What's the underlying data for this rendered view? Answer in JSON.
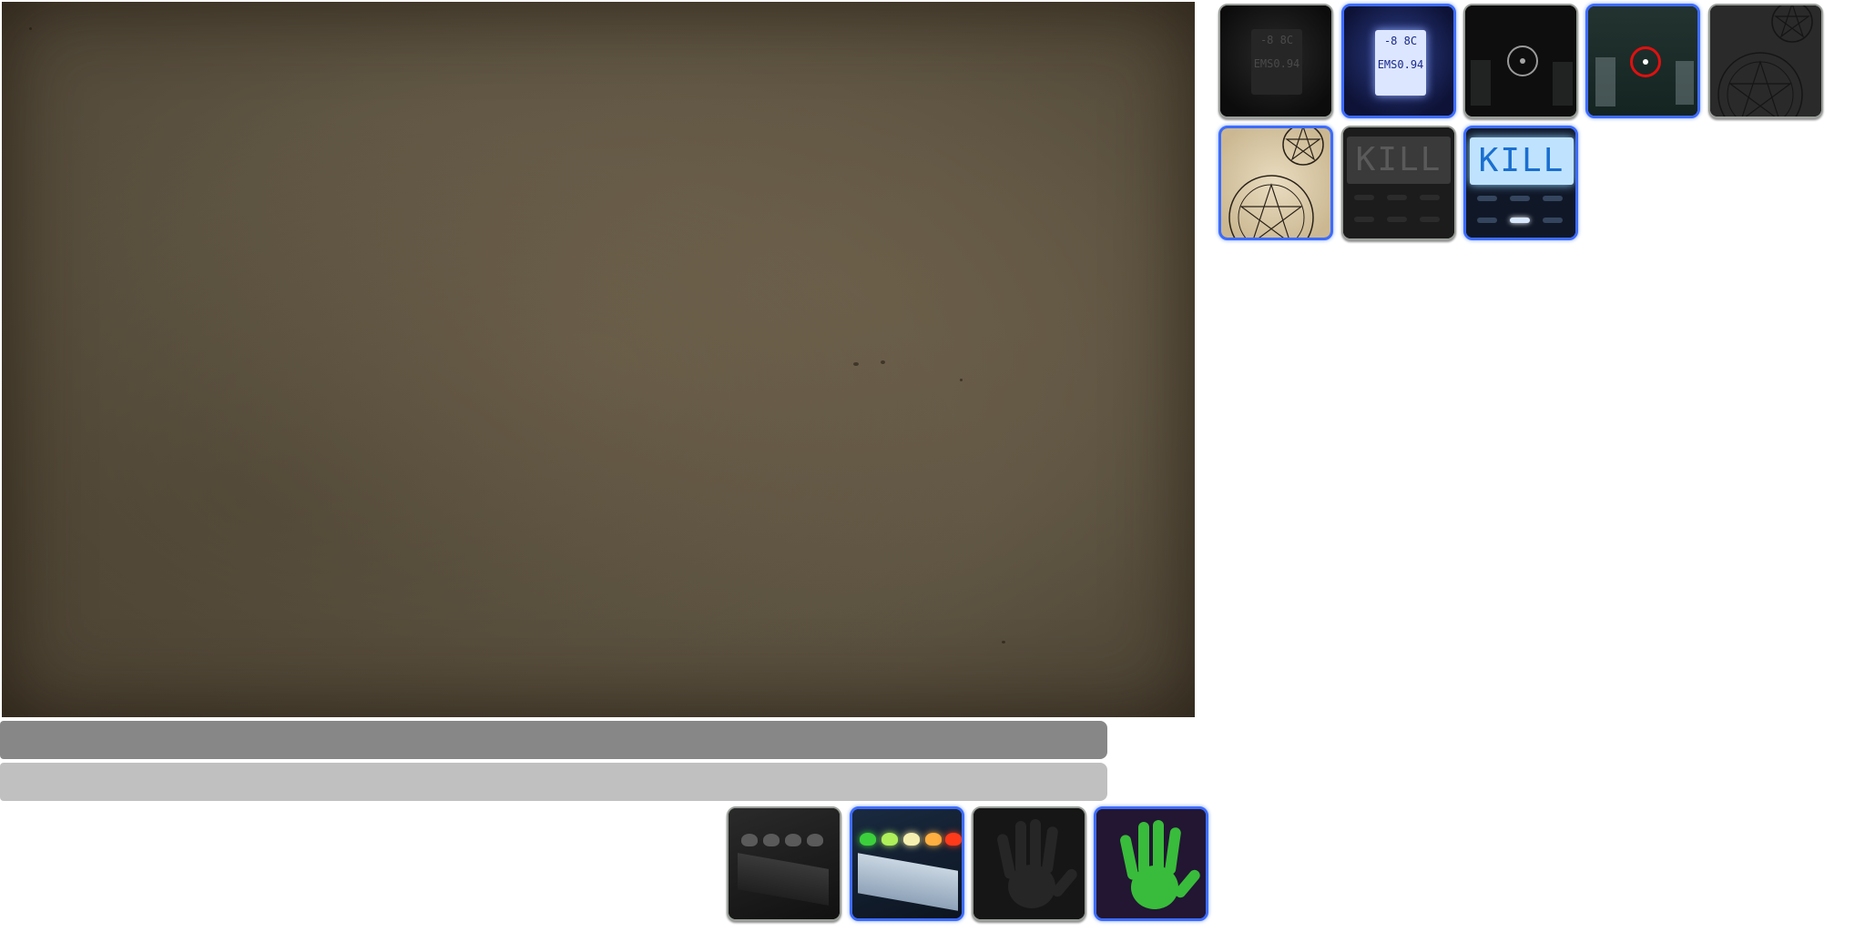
{
  "evidence_panels": [
    {
      "name": "emf-meter",
      "state": "off",
      "screen": {
        "line1": "-8 8C",
        "line2": "EMS0.94"
      }
    },
    {
      "name": "emf-meter",
      "state": "on",
      "screen": {
        "line1": "-8 8C",
        "line2": "EMS0.94"
      }
    },
    {
      "name": "ghost-orb-camera",
      "state": "off"
    },
    {
      "name": "ghost-orb-camera",
      "state": "on"
    },
    {
      "name": "ghost-writing-book",
      "state": "off"
    },
    {
      "name": "ghost-writing-book",
      "state": "on"
    },
    {
      "name": "spirit-box",
      "state": "off",
      "screen_text": "KILL"
    },
    {
      "name": "spirit-box",
      "state": "on",
      "screen_text": "KILL"
    }
  ],
  "bottom_panels": [
    {
      "name": "emf-level-leds",
      "state": "off"
    },
    {
      "name": "emf-level-leds",
      "state": "on"
    },
    {
      "name": "fingerprints",
      "state": "off"
    },
    {
      "name": "fingerprints",
      "state": "on"
    }
  ],
  "colors": {
    "active_border": "#3d6cff",
    "parchment": "#5f5543",
    "bar_dark": "#878787",
    "bar_light": "#c0c0c0",
    "ecto_green": "#3ccf3c",
    "camera_red": "#e01010"
  }
}
